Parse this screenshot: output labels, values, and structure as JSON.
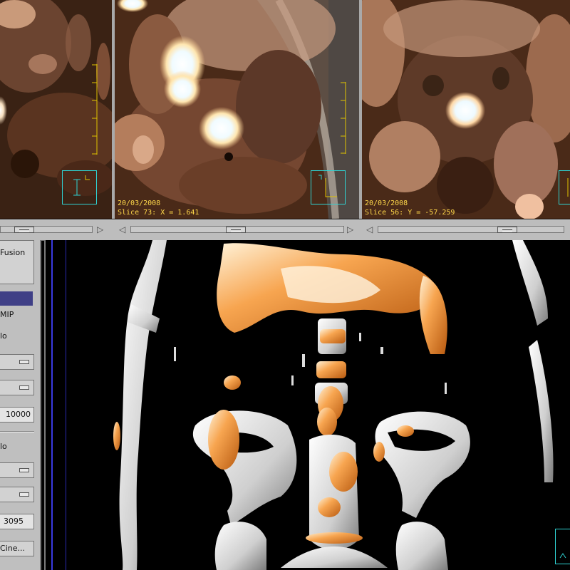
{
  "viewports": {
    "left": {
      "label": "axial-view"
    },
    "middle": {
      "date": "20/03/2008",
      "slice_text": "Slice 73: X = 1.641"
    },
    "right": {
      "date": "20/03/2008",
      "slice_text": "Slice 56: Y = -57.259"
    }
  },
  "side_panel": {
    "fusion_label": "Fusion",
    "mip_label": "MIP",
    "lo_label_1": "lo",
    "value_1": "10000",
    "lo_label_2": "lo",
    "value_2": "3095",
    "cine_label": "Cine..."
  },
  "colors": {
    "overlay_text": "#ffd84a",
    "cursor_box": "#2fd3d3",
    "ruler": "#e0c300",
    "selected": "#3f3f86"
  },
  "icons": [
    "left-arrow-icon",
    "right-arrow-icon",
    "orientation-icon"
  ]
}
